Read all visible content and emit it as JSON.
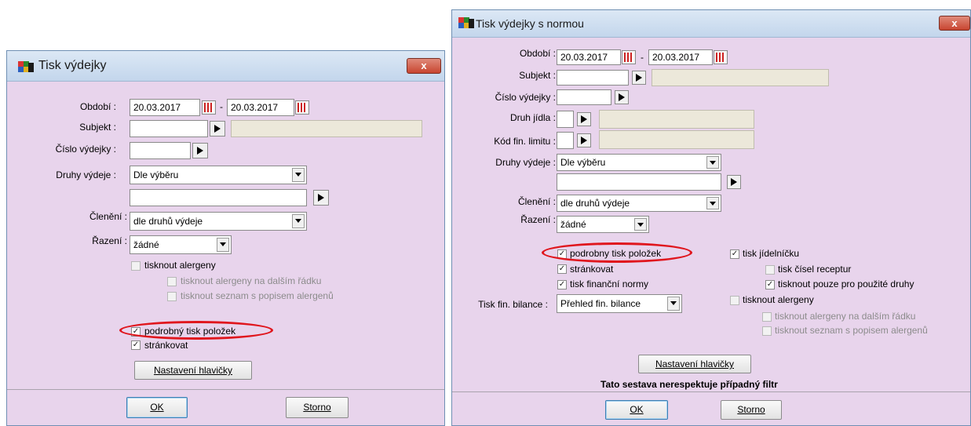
{
  "colors": {
    "dialog_bg": "#e8d4ec",
    "titlebar": "#c3d6ec",
    "close": "#c84530",
    "highlight": "#e0161d"
  },
  "left": {
    "title": "Tisk výdejky",
    "close": "x",
    "obdobi_label": "Období :",
    "date_from": "20.03.2017",
    "dash": "-",
    "date_to": "20.03.2017",
    "subjekt_label": "Subjekt :",
    "cislo_label": "Číslo výdejky :",
    "druhy_label": "Druhy výdeje :",
    "druhy_value": "Dle výběru",
    "cleneni_label": "Členění :",
    "cleneni_value": "dle druhů výdeje",
    "razeni_label": "Řazení :",
    "razeni_value": "žádné",
    "tisk_alergeny": "tisknout alergeny",
    "alergeny_radek": "tisknout alergeny na dalším řádku",
    "alergeny_seznam": "tisknout seznam s popisem alergenů",
    "podrobny": "podrobný tisk položek",
    "strankovat": "stránkovat",
    "check_mark": "✓",
    "nastaveni": "Nastavení hlavičky",
    "ok": "OK",
    "storno": "Storno"
  },
  "right": {
    "title": "Tisk výdejky s normou",
    "close": "x",
    "obdobi_label": "Období :",
    "date_from": "20.03.2017",
    "dash": "-",
    "date_to": "20.03.2017",
    "subjekt_label": "Subjekt :",
    "cislo_label": "Číslo výdejky :",
    "druh_jidla_label": "Druh jídla :",
    "kod_label": "Kód fin. limitu :",
    "druhy_label": "Druhy výdeje :",
    "druhy_value": "Dle výběru",
    "cleneni_label": "Členění :",
    "cleneni_value": "dle druhů výdeje",
    "razeni_label": "Řazení :",
    "razeni_value": "žádné",
    "podrobny": "podrobny tisk položek",
    "strankovat": "stránkovat",
    "tisk_fin_normy": "tisk finanční normy",
    "bilance_label": "Tisk fin. bilance :",
    "bilance_value": "Přehled fin. bilance",
    "tisk_jidelnicku": "tisk jídelníčku",
    "tisk_cisel": "tisk čísel receptur",
    "pouze_pouzite": "tisknout pouze pro použité druhy",
    "tisk_alergeny": "tisknout alergeny",
    "alergeny_radek": "tisknout alergeny na dalším řádku",
    "alergeny_seznam": "tisknout seznam s popisem alergenů",
    "nastaveni": "Nastavení hlavičky",
    "note": "Tato sestava nerespektuje případný filtr",
    "check_mark": "✓",
    "ok": "OK",
    "storno": "Storno"
  }
}
